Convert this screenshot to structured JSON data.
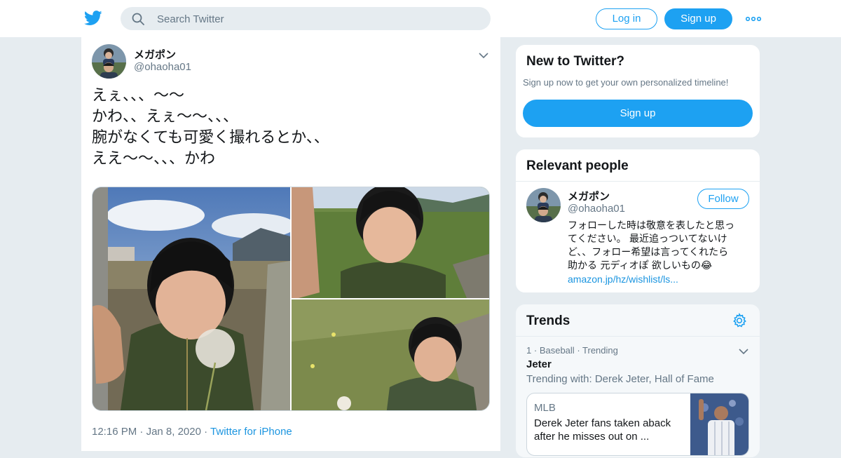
{
  "header": {
    "search_placeholder": "Search Twitter",
    "login_label": "Log in",
    "signup_label": "Sign up",
    "brand_color": "#1da1f2"
  },
  "tweet": {
    "author_name": "メガポン",
    "author_handle": "@ohaoha01",
    "text_lines": [
      "えぇ、、、〜〜",
      "かわ、、えぇ〜〜、、、",
      "腕がなくても可愛く撮れるとか、、",
      "ええ〜〜、、、かわ"
    ],
    "time": "12:16 PM",
    "date": "Jan 8, 2020",
    "source": "Twitter for iPhone",
    "photos": [
      "boy-with-dandelion-photo",
      "boy-in-field-photo",
      "boy-on-path-photo"
    ]
  },
  "sidebar": {
    "new_to_twitter": {
      "title": "New to Twitter?",
      "subtitle": "Sign up now to get your own personalized timeline!",
      "button": "Sign up"
    },
    "relevant_people": {
      "title": "Relevant people",
      "name": "メガポン",
      "handle": "@ohaoha01",
      "follow_label": "Follow",
      "bio_lines": [
        "フォローした時は敬意を表したと思っ",
        "てください。 最近追っついてないけ",
        "ど、、フォロー希望は言ってくれたら",
        "助かる 元ディオぽ 欲しいもの😂"
      ],
      "bio_link": "amazon.jp/hz/wishlist/ls..."
    },
    "trends": {
      "title": "Trends",
      "rank": "1",
      "category": "Baseball",
      "status": "Trending",
      "name": "Jeter",
      "trending_with": "Trending with: Derek Jeter, Hall of Fame",
      "news_source": "MLB",
      "news_headline": "Derek Jeter fans taken aback after he misses out on ..."
    }
  }
}
